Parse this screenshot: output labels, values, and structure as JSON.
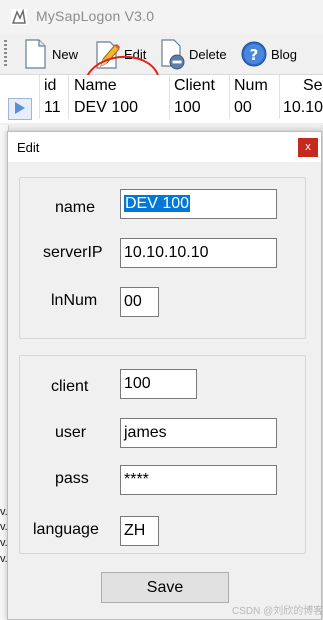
{
  "app": {
    "title": "MySapLogon V3.0"
  },
  "toolbar": {
    "new_label": "New",
    "edit_label": "Edit",
    "delete_label": "Delete",
    "blog_label": "Blog"
  },
  "grid": {
    "columns": [
      "id",
      "Name",
      "Client",
      "Num",
      "Se"
    ],
    "rows": [
      {
        "id": "11",
        "name": "DEV 100",
        "client": "100",
        "num": "00",
        "server": "10.10"
      }
    ]
  },
  "background_fragments": [
    "v.",
    "v.",
    "v.",
    "v."
  ],
  "dialog": {
    "title": "Edit",
    "close_glyph": "x",
    "labels": {
      "name": "name",
      "serverip": "serverIP",
      "lnnum": "lnNum",
      "client": "client",
      "user": "user",
      "pass": "pass",
      "language": "language"
    },
    "values": {
      "name": "DEV 100",
      "serverip": "10.10.10.10",
      "lnnum": "00",
      "client": "100",
      "user": "james",
      "pass": "****",
      "language": "ZH"
    },
    "save_label": "Save"
  },
  "watermark": "CSDN @刘欣的博客",
  "colors": {
    "accent": "#0078d7",
    "close_button": "#c42b1c",
    "annotation": "#e0241b"
  }
}
